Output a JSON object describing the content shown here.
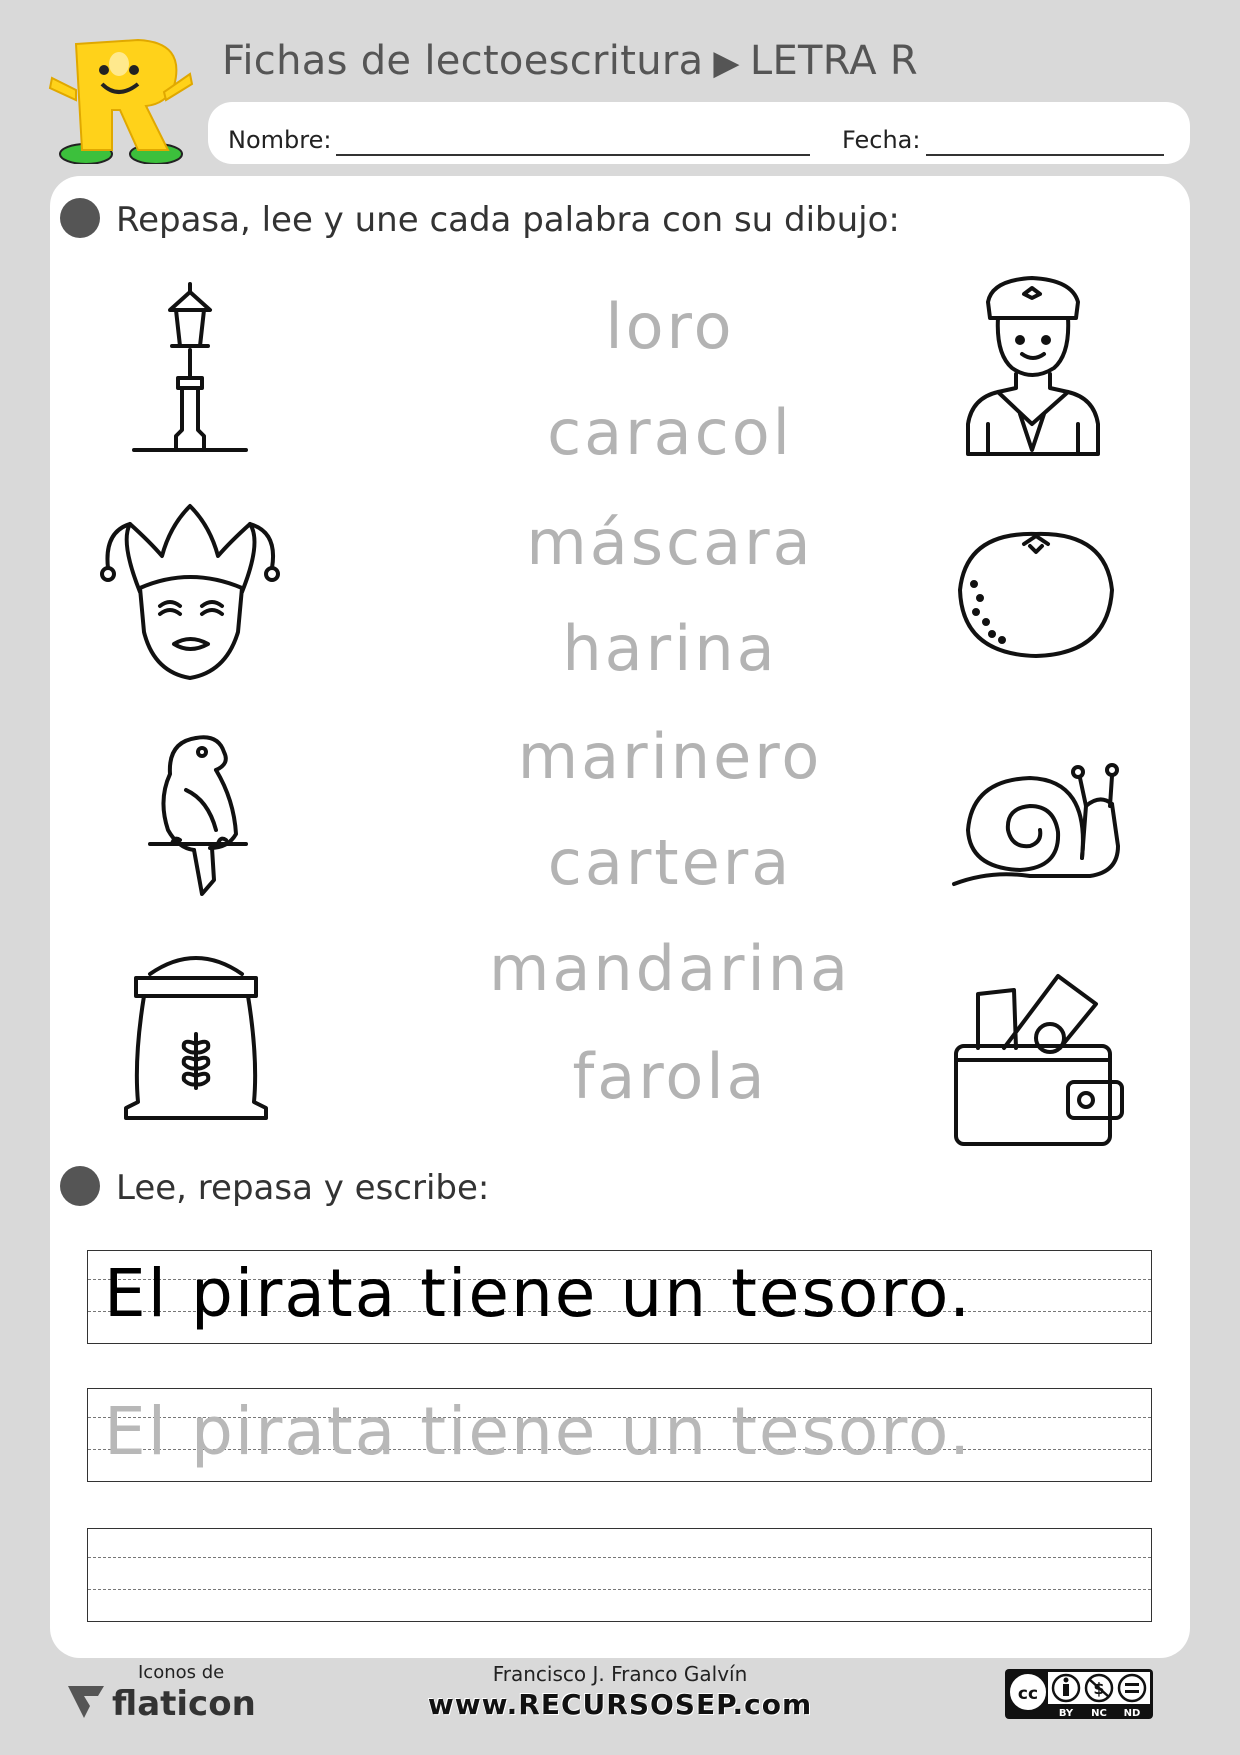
{
  "header": {
    "title": "Fichas de lectoescritura",
    "arrow": "▶",
    "letter": "LETRA R",
    "name_label": "Nombre:",
    "date_label": "Fecha:",
    "mascot_letter": "R"
  },
  "section1": {
    "instruction": "Repasa, lee y une cada palabra con su dibujo:",
    "left_pictures": [
      "lamppost-icon",
      "jester-mask-icon",
      "parrot-icon",
      "flour-sack-icon"
    ],
    "right_pictures": [
      "sailor-icon",
      "mandarin-icon",
      "snail-icon",
      "wallet-icon"
    ],
    "words": [
      "loro",
      "caracol",
      "máscara",
      "harina",
      "marinero",
      "cartera",
      "mandarina",
      "farola"
    ]
  },
  "section2": {
    "instruction": "Lee, repasa y escribe:",
    "sentence": "El pirata tiene un tesoro.",
    "trace_sentence": "El pirata tiene un tesoro."
  },
  "footer": {
    "icons_credit": "Iconos de",
    "icons_brand": "flaticon",
    "author": "Francisco J. Franco Galvín",
    "website": "www.RECURSOSEP.com",
    "license_labels": [
      "BY",
      "NC",
      "ND"
    ]
  },
  "colors": {
    "page_bg": "#d9d9d9",
    "trace_gray": "#b3b3b3",
    "mascot_yellow": "#ffd21a",
    "mascot_green": "#3cc03c"
  }
}
